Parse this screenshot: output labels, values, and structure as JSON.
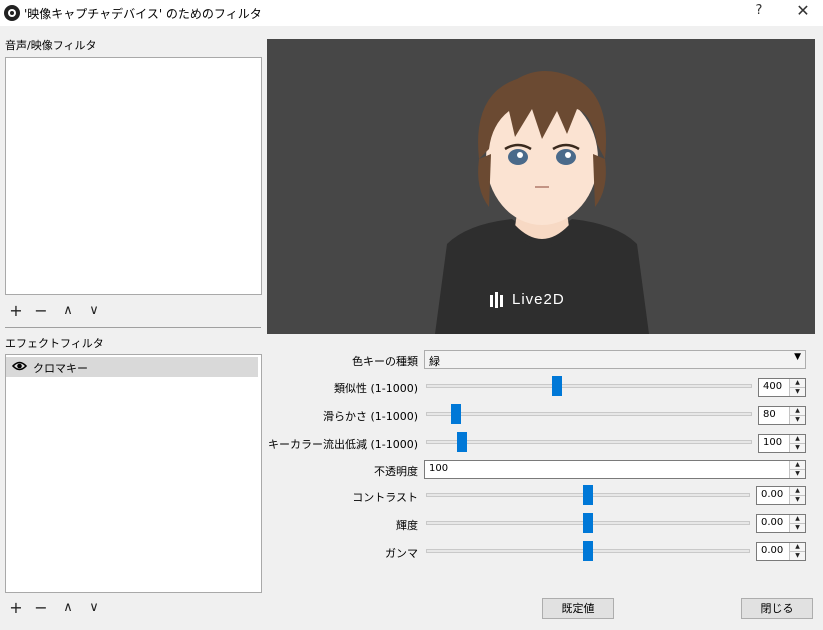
{
  "window": {
    "title": "'映像キャプチャデバイス' のためのフィルタ",
    "help": "?",
    "close": "✕"
  },
  "audio_video_filters": {
    "label": "音声/映像フィルタ",
    "items": []
  },
  "effect_filters": {
    "label": "エフェクトフィルタ",
    "items": [
      {
        "label": "クロマキー",
        "visible": true
      }
    ]
  },
  "toolbar": {
    "add": "+",
    "remove": "−",
    "up": "∧",
    "down": "∨"
  },
  "preview": {
    "shirt_logo": "Live2D"
  },
  "properties": {
    "key_color_type": {
      "label": "色キーの種類",
      "value": "緑"
    },
    "similarity": {
      "label": "類似性 (1-1000)",
      "value": "400",
      "level": 400,
      "min": 1,
      "max": 1000
    },
    "smoothness": {
      "label": "滑らかさ (1-1000)",
      "value": "80",
      "level": 80,
      "min": 1,
      "max": 1000
    },
    "spill_reduction": {
      "label": "キーカラー流出低減 (1-1000)",
      "value": "100",
      "level": 100,
      "min": 1,
      "max": 1000
    },
    "opacity": {
      "label": "不透明度",
      "value": "100"
    },
    "contrast": {
      "label": "コントラスト",
      "value": "0.00",
      "level": 0.5
    },
    "brightness": {
      "label": "輝度",
      "value": "0.00",
      "level": 0.5
    },
    "gamma": {
      "label": "ガンマ",
      "value": "0.00",
      "level": 0.5
    }
  },
  "buttons": {
    "defaults": "既定値",
    "close": "閉じる"
  },
  "colors": {
    "accent": "#0078d7",
    "preview_bg": "#474747",
    "selection": "#d9d9d9"
  }
}
